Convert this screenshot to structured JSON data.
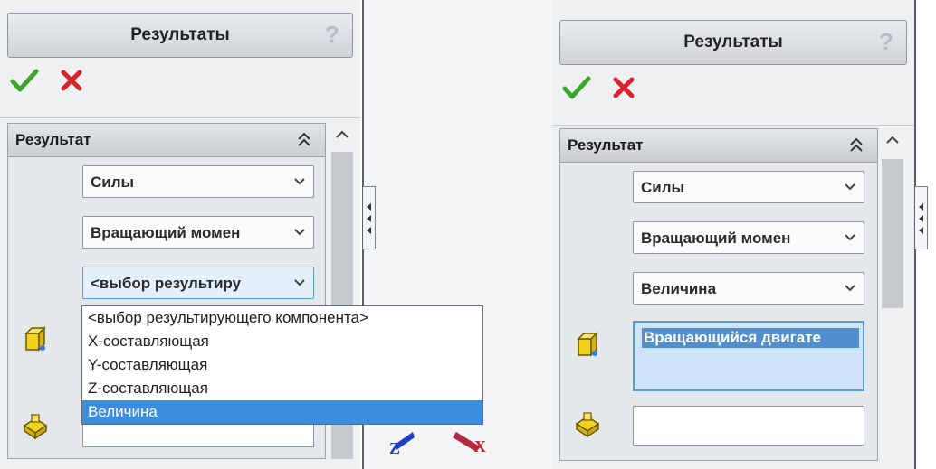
{
  "left_panel": {
    "title": "Результаты",
    "help_glyph": "?",
    "group": {
      "title": "Результат",
      "combos": [
        "Силы",
        "Вращающий момен",
        "<выбор результиру"
      ]
    },
    "dropdown_options": [
      "<выбор результирующего компонента>",
      "X-составляющая",
      "Y-составляющая",
      "Z-составляющая",
      "Величина"
    ],
    "selected_option": "Величина"
  },
  "right_panel": {
    "title": "Результаты",
    "help_glyph": "?",
    "group": {
      "title": "Результат",
      "combos": [
        "Силы",
        "Вращающий момен",
        "Величина"
      ]
    },
    "selected_component": "Вращающийся двигате",
    "face_field": ""
  },
  "triad": {
    "z_label": "Z",
    "x_label": "X"
  },
  "colors": {
    "accent": "#3b8ede",
    "ok_green": "#3aa52a",
    "cancel_red": "#d8232a",
    "part_icon_yellow": "#f2d21b"
  },
  "icons": {
    "ok": "green-checkmark-icon",
    "cancel": "red-x-icon",
    "component": "yellow-cube-component-icon",
    "face": "yellow-part-face-icon",
    "collapse": "double-chevron-up-icon",
    "dropdown": "chevron-down-icon"
  }
}
